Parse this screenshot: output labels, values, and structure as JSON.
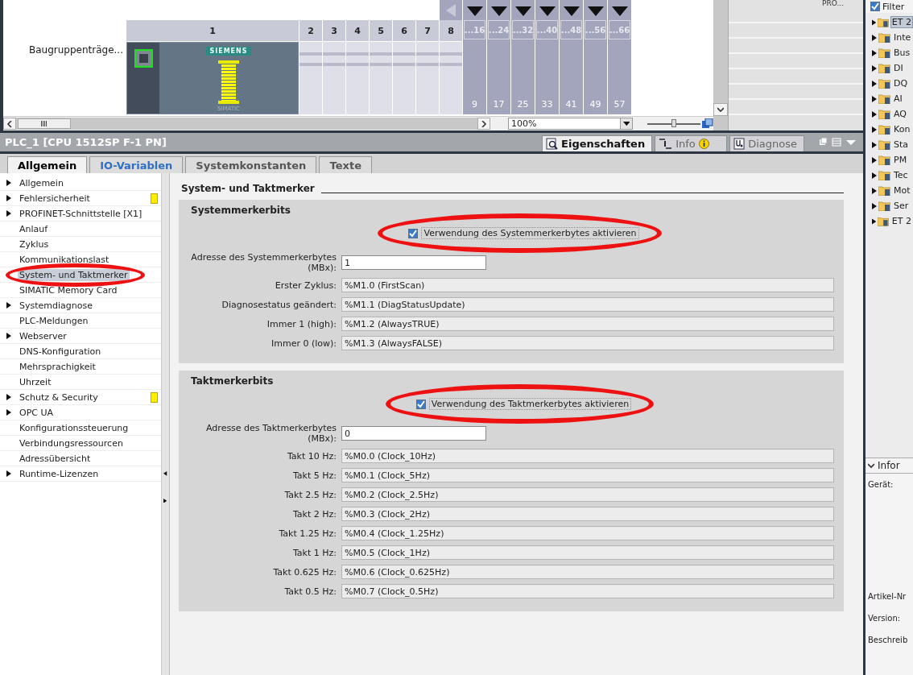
{
  "device_view": {
    "rack_label": "Baugruppenträge...",
    "module": {
      "slot": "1",
      "brand": "SIEMENS",
      "series": "SIMATIC"
    },
    "slots": [
      "2",
      "3",
      "4",
      "5",
      "6",
      "7",
      "8"
    ],
    "slot_groups": [
      {
        "header": "...16",
        "first": "9"
      },
      {
        "header": "...24",
        "first": "17"
      },
      {
        "header": "...32",
        "first": "25"
      },
      {
        "header": "...40",
        "first": "33"
      },
      {
        "header": "...48",
        "first": "41"
      },
      {
        "header": "...56",
        "first": "49"
      },
      {
        "header": "...66",
        "first": "57"
      }
    ],
    "zoom": "100%",
    "slider": {
      "level": 0.5
    },
    "table_text": "PRO..."
  },
  "inspector": {
    "title": "PLC_1 [CPU 1512SP F-1 PN]",
    "view_tabs": [
      {
        "label": "Eigenschaften",
        "selected": true,
        "kind": "properties"
      },
      {
        "label": "Info",
        "selected": false,
        "kind": "info"
      },
      {
        "label": "Diagnose",
        "selected": false,
        "kind": "diagnostics"
      }
    ],
    "tabs": [
      {
        "label": "Allgemein",
        "selected": true,
        "color": "#000000"
      },
      {
        "label": "IO-Variablen",
        "selected": false,
        "color": "#2f6fc4"
      },
      {
        "label": "Systemkonstanten",
        "selected": false,
        "color": "#555555"
      },
      {
        "label": "Texte",
        "selected": false,
        "color": "#555555"
      }
    ],
    "nav": [
      {
        "label": "Allgemein",
        "expandable": true,
        "selected": false,
        "flag": false,
        "circled": false
      },
      {
        "label": "Fehlersicherheit",
        "expandable": true,
        "selected": false,
        "flag": true,
        "circled": false
      },
      {
        "label": "PROFINET-Schnittstelle [X1]",
        "expandable": true,
        "selected": false,
        "flag": false,
        "circled": false
      },
      {
        "label": "Anlauf",
        "expandable": false,
        "selected": false,
        "flag": false,
        "circled": false
      },
      {
        "label": "Zyklus",
        "expandable": false,
        "selected": false,
        "flag": false,
        "circled": false
      },
      {
        "label": "Kommunikationslast",
        "expandable": false,
        "selected": false,
        "flag": false,
        "circled": false
      },
      {
        "label": "System- und Taktmerker",
        "expandable": false,
        "selected": true,
        "flag": false,
        "circled": true
      },
      {
        "label": "SIMATIC Memory Card",
        "expandable": false,
        "selected": false,
        "flag": false,
        "circled": false
      },
      {
        "label": "Systemdiagnose",
        "expandable": true,
        "selected": false,
        "flag": false,
        "circled": false
      },
      {
        "label": "PLC-Meldungen",
        "expandable": false,
        "selected": false,
        "flag": false,
        "circled": false
      },
      {
        "label": "Webserver",
        "expandable": true,
        "selected": false,
        "flag": false,
        "circled": false
      },
      {
        "label": "DNS-Konfiguration",
        "expandable": false,
        "selected": false,
        "flag": false,
        "circled": false
      },
      {
        "label": "Mehrsprachigkeit",
        "expandable": false,
        "selected": false,
        "flag": false,
        "circled": false
      },
      {
        "label": "Uhrzeit",
        "expandable": false,
        "selected": false,
        "flag": false,
        "circled": false
      },
      {
        "label": "Schutz & Security",
        "expandable": true,
        "selected": false,
        "flag": true,
        "circled": false
      },
      {
        "label": "OPC UA",
        "expandable": true,
        "selected": false,
        "flag": false,
        "circled": false
      },
      {
        "label": "Konfigurationssteuerung",
        "expandable": false,
        "selected": false,
        "flag": false,
        "circled": false
      },
      {
        "label": "Verbindungsressourcen",
        "expandable": false,
        "selected": false,
        "flag": false,
        "circled": false
      },
      {
        "label": "Adressübersicht",
        "expandable": false,
        "selected": false,
        "flag": false,
        "circled": false
      },
      {
        "label": "Runtime-Lizenzen",
        "expandable": true,
        "selected": false,
        "flag": false,
        "circled": false
      }
    ],
    "section_title": "System- und Taktmerker",
    "groups": [
      {
        "title": "Systemmerkerbits",
        "checkbox": {
          "label": "Verwendung des Systemmerkerbytes aktivieren",
          "checked": true,
          "circled": true
        },
        "address": {
          "label": "Adresse des Systemmerkerbytes (MBx):",
          "value": "1"
        },
        "fields": [
          {
            "label": "Erster Zyklus:",
            "value": "%M1.0 (FirstScan)"
          },
          {
            "label": "Diagnosestatus geändert:",
            "value": "%M1.1 (DiagStatusUpdate)"
          },
          {
            "label": "Immer 1 (high):",
            "value": "%M1.2 (AlwaysTRUE)"
          },
          {
            "label": "Immer 0 (low):",
            "value": "%M1.3 (AlwaysFALSE)"
          }
        ]
      },
      {
        "title": "Taktmerkerbits",
        "checkbox": {
          "label": "Verwendung des Taktmerkerbytes aktivieren",
          "checked": true,
          "circled": true
        },
        "address": {
          "label": "Adresse des Taktmerkerbytes (MBx):",
          "value": "0"
        },
        "fields": [
          {
            "label": "Takt 10 Hz:",
            "value": "%M0.0 (Clock_10Hz)"
          },
          {
            "label": "Takt 5 Hz:",
            "value": "%M0.1 (Clock_5Hz)"
          },
          {
            "label": "Takt 2.5 Hz:",
            "value": "%M0.2 (Clock_2.5Hz)"
          },
          {
            "label": "Takt 2 Hz:",
            "value": "%M0.3 (Clock_2Hz)"
          },
          {
            "label": "Takt 1.25 Hz:",
            "value": "%M0.4 (Clock_1.25Hz)"
          },
          {
            "label": "Takt 1 Hz:",
            "value": "%M0.5 (Clock_1Hz)"
          },
          {
            "label": "Takt 0.625 Hz:",
            "value": "%M0.6 (Clock_0.625Hz)"
          },
          {
            "label": "Takt 0.5 Hz:",
            "value": "%M0.7 (Clock_0.5Hz)"
          }
        ]
      }
    ]
  },
  "catalog": {
    "filter": {
      "label": "Filter",
      "checked": true
    },
    "items": [
      {
        "label": "ET 2",
        "selected": true
      },
      {
        "label": "Inte",
        "selected": false
      },
      {
        "label": "Bus",
        "selected": false
      },
      {
        "label": "DI",
        "selected": false
      },
      {
        "label": "DQ",
        "selected": false
      },
      {
        "label": "AI",
        "selected": false
      },
      {
        "label": "AQ",
        "selected": false
      },
      {
        "label": "Kon",
        "selected": false
      },
      {
        "label": "Sta",
        "selected": false
      },
      {
        "label": "PM",
        "selected": false
      },
      {
        "label": "Tec",
        "selected": false
      },
      {
        "label": "Mot",
        "selected": false
      },
      {
        "label": "Ser",
        "selected": false
      },
      {
        "label": "ET 2",
        "selected": false
      }
    ],
    "info_title": "Infor",
    "info_labels": [
      {
        "label": "Gerät:",
        "kind": "device"
      },
      {
        "label": "Artikel-Nr",
        "kind": "article"
      },
      {
        "label": "Version:",
        "kind": "version"
      },
      {
        "label": "Beschreib",
        "kind": "description"
      }
    ]
  }
}
